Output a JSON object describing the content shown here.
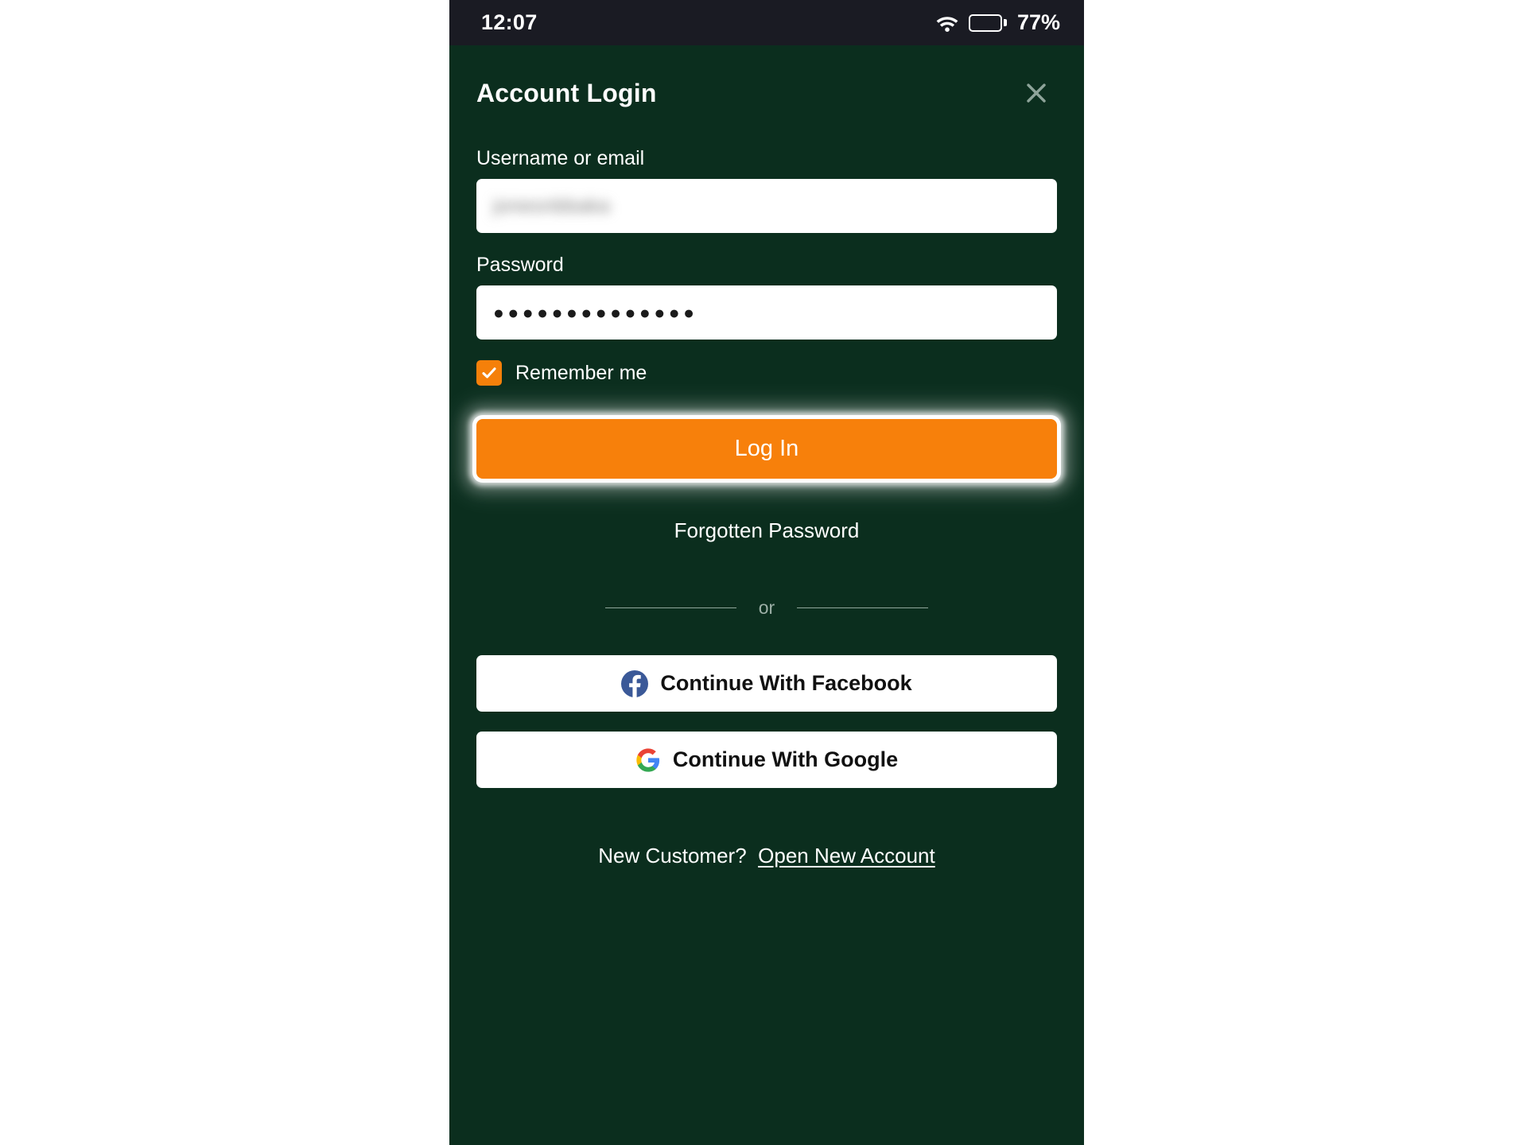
{
  "theme": {
    "background_green": "#0b2e1e",
    "status_bar": "#1a1b23",
    "accent_orange": "#f7800b",
    "surface_white": "#ffffff",
    "muted_text": "#9db0a7"
  },
  "status_bar": {
    "time": "12:07",
    "wifi_icon": "wifi-icon",
    "battery_icon": "battery-icon",
    "battery_level_pct": 77,
    "battery_text": "77%"
  },
  "header": {
    "title": "Account Login",
    "close_icon": "close-icon",
    "close_glyph": "✕"
  },
  "form": {
    "username": {
      "label": "Username or email",
      "value": "jonesnbbaka",
      "redacted": true,
      "placeholder": "Username or email"
    },
    "password": {
      "label": "Password",
      "value": "●●●●●●●●●●●●●●",
      "placeholder": "Password",
      "masked": true,
      "character_count": 14
    },
    "remember_me": {
      "label": "Remember me",
      "checked": true,
      "check_glyph": "✔"
    }
  },
  "actions": {
    "login_label": "Log In",
    "login_focused": true,
    "forgot_password_label": "Forgotten Password"
  },
  "divider": {
    "text": "or"
  },
  "social": {
    "buttons": [
      {
        "label": "Continue With Facebook",
        "icon": "facebook-icon",
        "brand_color": "#3b5998"
      },
      {
        "label": "Continue With Google",
        "icon": "google-icon",
        "brand_color": "#4285f4"
      }
    ]
  },
  "footer": {
    "prompt": "New Customer?",
    "link_label": "Open New Account"
  }
}
